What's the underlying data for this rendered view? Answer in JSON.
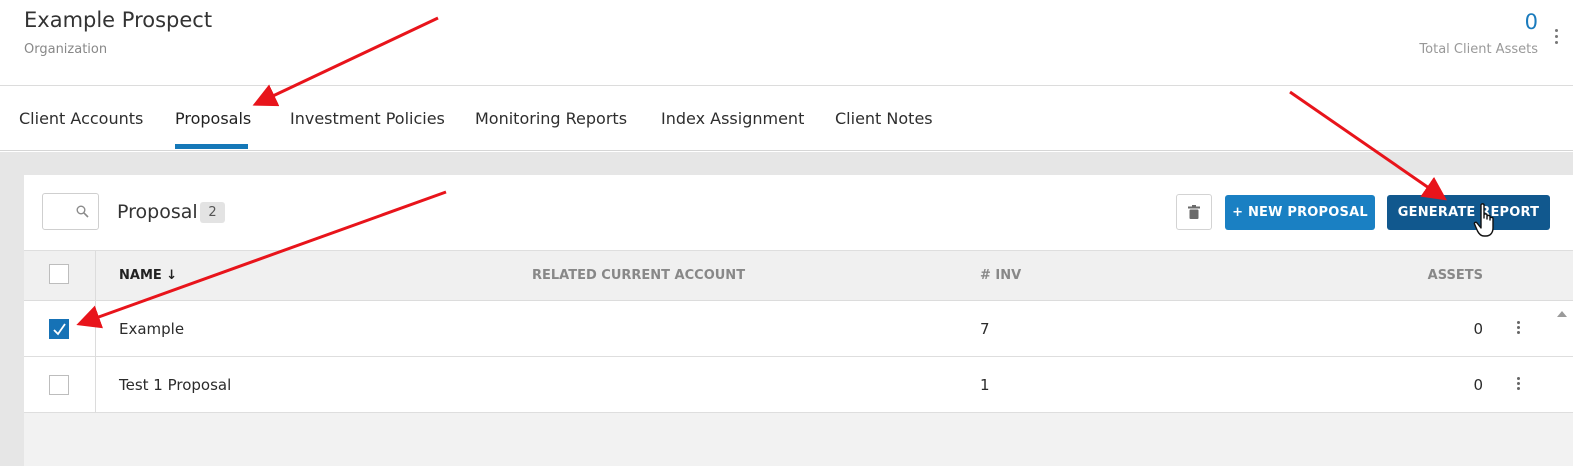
{
  "header": {
    "title": "Example Prospect",
    "subtitle": "Organization",
    "total_assets_value": "0",
    "total_assets_label": "Total Client Assets"
  },
  "tabs": [
    {
      "label": "Client Accounts",
      "active": false
    },
    {
      "label": "Proposals",
      "active": true
    },
    {
      "label": "Investment Policies",
      "active": false
    },
    {
      "label": "Monitoring Reports",
      "active": false
    },
    {
      "label": "Index Assignment",
      "active": false
    },
    {
      "label": "Client Notes",
      "active": false
    }
  ],
  "toolbar": {
    "search_placeholder": "",
    "section_title": "Proposal",
    "count": "2",
    "new_label": "+ NEW PROPOSAL",
    "generate_label": "GENERATE REPORT"
  },
  "table": {
    "columns": {
      "name": "NAME ↓",
      "related": "RELATED CURRENT ACCOUNT",
      "inv": "# INV",
      "assets": "ASSETS"
    },
    "rows": [
      {
        "checked": true,
        "name": "Example",
        "related": "",
        "inv": "7",
        "assets": "0"
      },
      {
        "checked": false,
        "name": "Test 1 Proposal",
        "related": "",
        "inv": "1",
        "assets": "0"
      }
    ]
  },
  "colors": {
    "accent": "#1a80c3",
    "primary_dark": "#11588e",
    "annotation": "#e8141b"
  },
  "icons": [
    "kebab-icon",
    "search-icon",
    "trash-icon",
    "check-icon",
    "hand-cursor-icon",
    "scroll-up-icon"
  ]
}
